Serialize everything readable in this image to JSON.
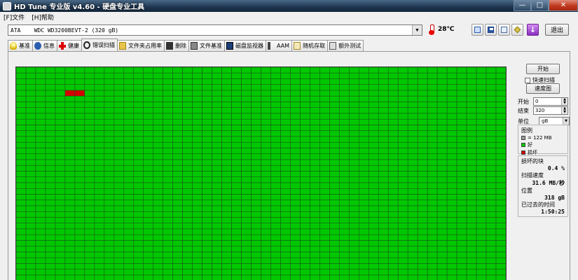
{
  "window": {
    "title": "HD Tune 专业版 v4.60 - 硬盘专业工具"
  },
  "menu": {
    "items": [
      "[F]文件",
      "[H]帮助"
    ]
  },
  "toolbar": {
    "drive": "ATA    WDC WD3200BEVT-2 (320 gB)",
    "temperature": "28℃",
    "exit_label": "退出"
  },
  "tabs": [
    {
      "label": "基准",
      "icon": "bulb-icon"
    },
    {
      "label": "信息",
      "icon": "info-icon"
    },
    {
      "label": "健康",
      "icon": "health-cross-icon"
    },
    {
      "label": "错误扫描",
      "icon": "magnifier-icon",
      "active": true
    },
    {
      "label": "文件夹占用率",
      "icon": "folder-icon"
    },
    {
      "label": "删除",
      "icon": "trash-icon"
    },
    {
      "label": "文件基准",
      "icon": "file-benchmark-icon"
    },
    {
      "label": "磁盘监视器",
      "icon": "monitor-icon"
    },
    {
      "label": "AAM",
      "icon": "speaker-icon"
    },
    {
      "label": "随机存取",
      "icon": "random-access-icon"
    },
    {
      "label": "额外测试",
      "icon": "extra-tests-icon"
    }
  ],
  "scan": {
    "start_button": "开始",
    "quick_scan_label": "快速扫描",
    "speed_map_button": "速度图",
    "start_label": "开始",
    "start_value": "0",
    "end_label": "结束",
    "end_value": "320",
    "unit_label": "单位",
    "unit_value": "gB"
  },
  "legend": {
    "title": "图例",
    "block_size": "= 122 MB",
    "good": "好",
    "bad": "损坏",
    "good_color": "#00c800",
    "bad_color": "#d40000"
  },
  "stats": {
    "damaged_label": "损坏的块",
    "damaged_value": "0.4 %",
    "speed_label": "扫描速度",
    "speed_value": "31.6 MB/秒",
    "position_label": "位置",
    "position_value": "318 gB",
    "elapsed_label": "已过去的时间",
    "elapsed_value": "1:50:25"
  },
  "block_map": {
    "columns": 50,
    "rows_visible": 37,
    "bad_blocks": [
      [
        4,
        5
      ],
      [
        4,
        6
      ]
    ]
  }
}
